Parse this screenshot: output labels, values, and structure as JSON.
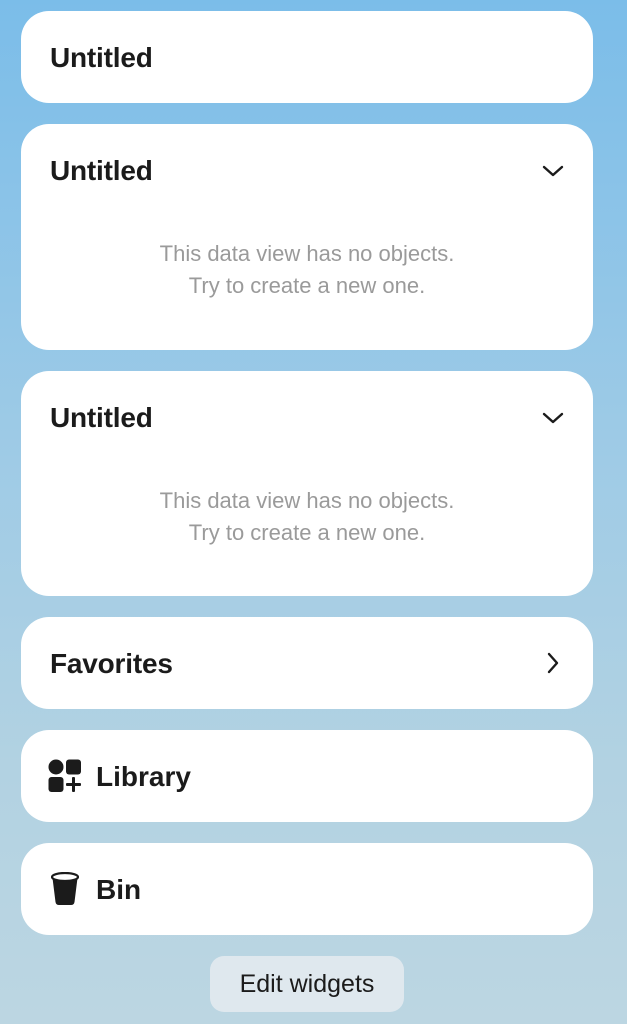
{
  "widgets": [
    {
      "title": "Untitled"
    },
    {
      "title": "Untitled",
      "empty_line1": "This data view has no objects.",
      "empty_line2": "Try to create a new one.",
      "toggle_icon": "chevron-down-icon"
    },
    {
      "title": "Untitled",
      "empty_line1": "This data view has no objects.",
      "empty_line2": "Try to create a new one.",
      "toggle_icon": "chevron-down-icon"
    },
    {
      "title": "Favorites",
      "nav_icon": "chevron-right-icon"
    },
    {
      "title": "Library",
      "icon": "library-shapes-icon"
    },
    {
      "title": "Bin",
      "icon": "bin-icon"
    }
  ],
  "footer": {
    "edit_label": "Edit widgets"
  },
  "colors": {
    "background_top": "#7bbde9",
    "background_bottom": "#bcd6e2",
    "card": "#ffffff",
    "text": "#1b1b1b",
    "muted_text": "#9a9a9a",
    "edit_button": "#dfe8ee"
  }
}
